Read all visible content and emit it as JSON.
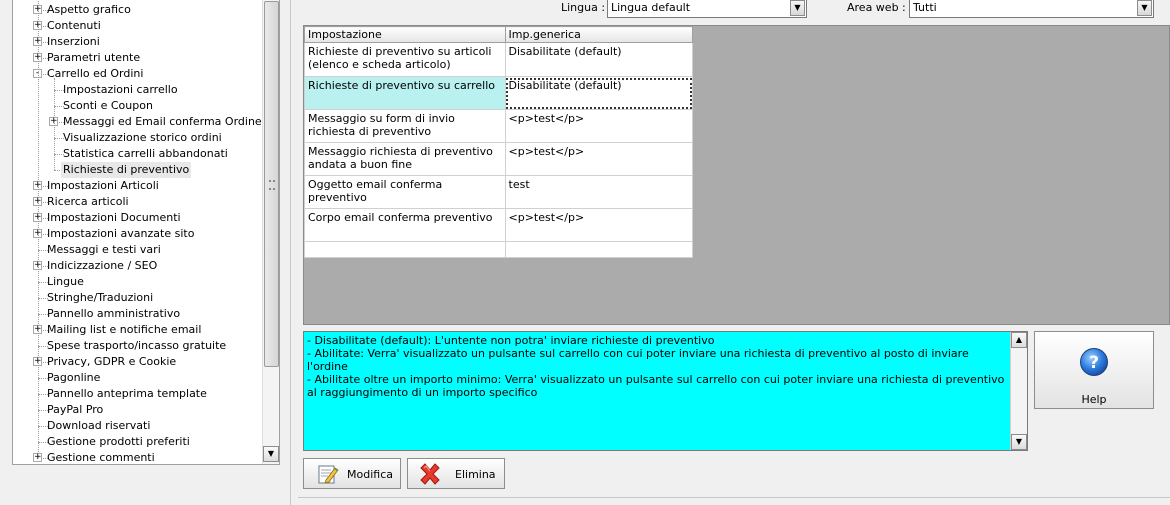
{
  "tree": {
    "items": [
      {
        "label": "Aspetto grafico",
        "level": 0,
        "expander": "+"
      },
      {
        "label": "Contenuti",
        "level": 0,
        "expander": "+"
      },
      {
        "label": "Inserzioni",
        "level": 0,
        "expander": "+"
      },
      {
        "label": "Parametri utente",
        "level": 0,
        "expander": "+"
      },
      {
        "label": "Carrello ed Ordini",
        "level": 0,
        "expander": "-"
      },
      {
        "label": "Impostazioni carrello",
        "level": 1,
        "expander": ""
      },
      {
        "label": "Sconti e Coupon",
        "level": 1,
        "expander": ""
      },
      {
        "label": "Messaggi ed Email conferma Ordine",
        "level": 1,
        "expander": "+"
      },
      {
        "label": "Visualizzazione storico ordini",
        "level": 1,
        "expander": ""
      },
      {
        "label": "Statistica carrelli abbandonati",
        "level": 1,
        "expander": ""
      },
      {
        "label": "Richieste di preventivo",
        "level": 1,
        "expander": "",
        "selected": true
      },
      {
        "label": "Impostazioni Articoli",
        "level": 0,
        "expander": "+"
      },
      {
        "label": "Ricerca articoli",
        "level": 0,
        "expander": "+"
      },
      {
        "label": "Impostazioni Documenti",
        "level": 0,
        "expander": "+"
      },
      {
        "label": "Impostazioni avanzate sito",
        "level": 0,
        "expander": "+"
      },
      {
        "label": "Messaggi e testi vari",
        "level": 0,
        "expander": ""
      },
      {
        "label": "Indicizzazione / SEO",
        "level": 0,
        "expander": "+"
      },
      {
        "label": "Lingue",
        "level": 0,
        "expander": ""
      },
      {
        "label": "Stringhe/Traduzioni",
        "level": 0,
        "expander": ""
      },
      {
        "label": "Pannello amministrativo",
        "level": 0,
        "expander": ""
      },
      {
        "label": "Mailing list e notifiche email",
        "level": 0,
        "expander": "+"
      },
      {
        "label": "Spese trasporto/incasso gratuite",
        "level": 0,
        "expander": ""
      },
      {
        "label": "Privacy, GDPR e Cookie",
        "level": 0,
        "expander": "+"
      },
      {
        "label": "Pagonline",
        "level": 0,
        "expander": ""
      },
      {
        "label": "Pannello anteprima template",
        "level": 0,
        "expander": ""
      },
      {
        "label": "PayPal Pro",
        "level": 0,
        "expander": ""
      },
      {
        "label": "Download riservati",
        "level": 0,
        "expander": ""
      },
      {
        "label": "Gestione prodotti preferiti",
        "level": 0,
        "expander": ""
      },
      {
        "label": "Gestione commenti",
        "level": 0,
        "expander": "+"
      }
    ]
  },
  "filters": {
    "lingua_label": "Lingua :",
    "lingua_value": "Lingua default",
    "area_label": "Area web :",
    "area_value": "Tutti"
  },
  "grid": {
    "headers": [
      "Impostazione",
      "Imp.generica"
    ],
    "rows": [
      {
        "key": "Richieste di preventivo su articoli (elenco e scheda articolo)",
        "value": "Disabilitate (default)"
      },
      {
        "key": "Richieste di preventivo su carrello",
        "value": "Disabilitate (default)",
        "selected": true
      },
      {
        "key": "Messaggio su form di invio richiesta di preventivo",
        "value": "<p>test</p>"
      },
      {
        "key": "Messaggio richiesta di preventivo andata a buon fine",
        "value": "<p>test</p>"
      },
      {
        "key": "Oggetto email conferma preventivo",
        "value": "test"
      },
      {
        "key": "Corpo email conferma preventivo",
        "value": "<p>test</p>"
      },
      {
        "key": "",
        "value": ""
      }
    ]
  },
  "description": {
    "lines": [
      "- Disabilitate (default): L'untente non potra' inviare richieste di preventivo",
      "- Abilitate: Verra' visualizzato un pulsante sul carrello con cui poter inviare una richiesta di preventivo al posto di inviare l'ordine",
      "- Abilitate oltre un importo minimo: Verra' visualizzato un pulsante sul carrello con cui poter inviare una richiesta di preventivo al raggiungimento di un importo specifico"
    ]
  },
  "buttons": {
    "help": "Help",
    "modifica": "Modifica",
    "elimina": "Elimina"
  },
  "colors": {
    "description_bg": "#00ffff",
    "selected_cell_bg": "#b9f0f0",
    "grid_area_bg": "#ababab"
  },
  "icons": {
    "help": "question-mark-icon",
    "modifica": "edit-pencil-icon",
    "elimina": "delete-x-icon"
  }
}
